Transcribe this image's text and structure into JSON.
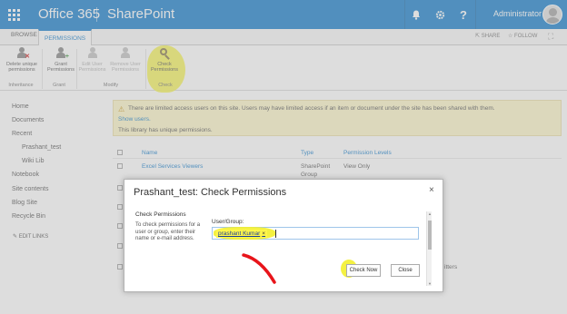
{
  "suite_bar": {
    "brand": "Office 365",
    "product": "SharePoint",
    "user_name": "Administrator",
    "help_label": "?"
  },
  "tabs": {
    "browse": "BROWSE",
    "permissions": "PERMISSIONS",
    "share": "SHARE",
    "follow": "FOLLOW"
  },
  "ribbon": {
    "buttons": [
      {
        "label_1": "Delete unique",
        "label_2": "permissions",
        "icon": "delete-permissions-icon"
      },
      {
        "label_1": "Grant",
        "label_2": "Permissions",
        "icon": "grant-permissions-icon"
      },
      {
        "label_1": "Edit User",
        "label_2": "Permissions",
        "icon": "edit-user-icon"
      },
      {
        "label_1": "Remove User",
        "label_2": "Permissions",
        "icon": "remove-user-icon"
      },
      {
        "label_1": "Check",
        "label_2": "Permissions",
        "icon": "magnifier-icon"
      }
    ],
    "groups": [
      "Inheritance",
      "Grant",
      "Modify",
      "Check"
    ]
  },
  "left_nav": {
    "items": [
      "Home",
      "Documents",
      "Recent",
      "Prashant_test",
      "Wiki Lib",
      "Notebook",
      "Site contents",
      "Blog Site",
      "Recycle Bin"
    ],
    "edit_links": "EDIT LINKS"
  },
  "banner": {
    "line_1": "There are limited access users on this site. Users may have limited access if an item or document under the site has been shared with them.",
    "line_2": "Show users.",
    "line_3": "This library has unique permissions."
  },
  "table": {
    "headers": {
      "name": "Name",
      "type": "Type",
      "levels": "Permission Levels"
    },
    "rows": [
      {
        "name": "Excel Services Viewers",
        "type_1": "SharePoint",
        "type_2": "Group",
        "levels": "View Only"
      }
    ],
    "partial_text": "itters"
  },
  "dialog": {
    "title": "Prashant_test: Check Permissions",
    "close": "×",
    "section_title": "Check Permissions",
    "description": "To check permissions for a user or group, enter their name or e-mail address.",
    "field_label": "User/Group:",
    "token_value": "prashant Kumar",
    "token_remove": "×",
    "check_now": "Check Now",
    "close_button": "Close"
  },
  "colors": {
    "suite_blue": "#0072c6",
    "highlight_yellow": "#f3f02c",
    "annotation_red": "#e8141a"
  }
}
